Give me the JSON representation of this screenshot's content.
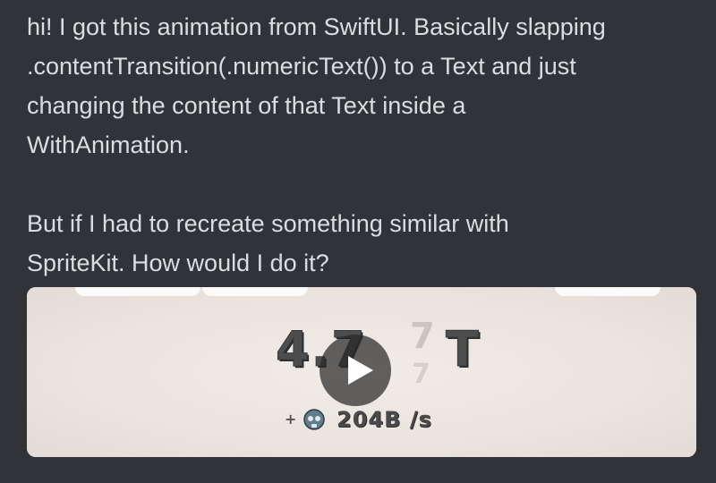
{
  "message": {
    "paragraphs": [
      "hi! I got this animation from SwiftUI. Basically slapping\n.contentTransition(.numericText()) to a Text and just\nchanging the content of that Text inside a\nWithAnimation.",
      "But if I had to recreate something similar with\nSpriteKit. How would I do it?"
    ]
  },
  "video": {
    "counter_value": "4.7",
    "counter_ghost_digit": "7",
    "counter_suffix": "T",
    "rate_prefix": "+",
    "rate_text": "204B /s",
    "rate_icon": "skull-icon",
    "play_icon": "play-icon"
  },
  "colors": {
    "background": "#313338",
    "text": "#dbdee1",
    "video_bg": "#ede6e1"
  }
}
